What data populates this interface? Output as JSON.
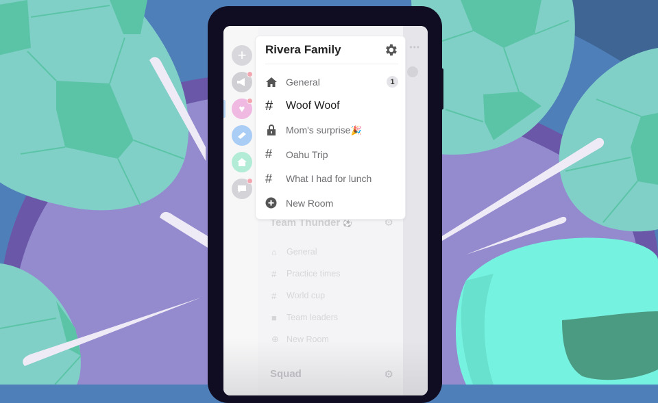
{
  "colors": {
    "background_blue": "#4f7fb9",
    "background_purple": "#948bcf",
    "ball_teal": "#80d0c8",
    "ball_green": "#5cc4a6",
    "blob_mint": "#76f3e0",
    "phone_frame": "#100d22"
  },
  "server_rail": {
    "items": [
      {
        "name": "add-server",
        "icon": "plus-icon",
        "color": "#d8d8dc",
        "unread": false
      },
      {
        "name": "megaphone-server",
        "icon": "megaphone-icon",
        "color": "#d0d0d4",
        "unread": true
      },
      {
        "name": "heart-server",
        "icon": "heart-icon",
        "color": "#efb9e2",
        "unread": true
      },
      {
        "name": "book-server",
        "icon": "book-icon",
        "color": "#a9cdf4",
        "unread": false
      },
      {
        "name": "home-server",
        "icon": "home-icon",
        "color": "#b3ecd6",
        "unread": false
      },
      {
        "name": "chat-server",
        "icon": "chat-icon",
        "color": "#d4d4d8",
        "unread": true
      }
    ]
  },
  "active_server": {
    "name": "Rivera Family",
    "settings_icon": "gear-icon",
    "rooms": [
      {
        "icon": "home-icon",
        "label": "General",
        "badge": "1",
        "active": false
      },
      {
        "icon": "hash-icon",
        "label": "Woof Woof",
        "active": true
      },
      {
        "icon": "lock-icon",
        "label": "Mom's surprise",
        "emoji": "🎉",
        "active": false
      },
      {
        "icon": "hash-icon",
        "label": "Oahu Trip",
        "active": false
      },
      {
        "icon": "hash-icon",
        "label": "What I had for lunch",
        "active": false
      },
      {
        "icon": "plus-circle-icon",
        "label": "New Room",
        "active": false
      }
    ]
  },
  "other_servers": [
    {
      "name": "Team Thunder",
      "emoji": "⚽",
      "rooms": [
        {
          "icon": "home-icon",
          "label": "General"
        },
        {
          "icon": "hash-icon",
          "label": "Practice times"
        },
        {
          "icon": "hash-icon",
          "label": "World cup"
        },
        {
          "icon": "lock-icon",
          "label": "Team leaders"
        },
        {
          "icon": "plus-circle-icon",
          "label": "New Room"
        }
      ]
    },
    {
      "name": "Squad"
    }
  ],
  "right_strip": {
    "menu": "•••"
  }
}
